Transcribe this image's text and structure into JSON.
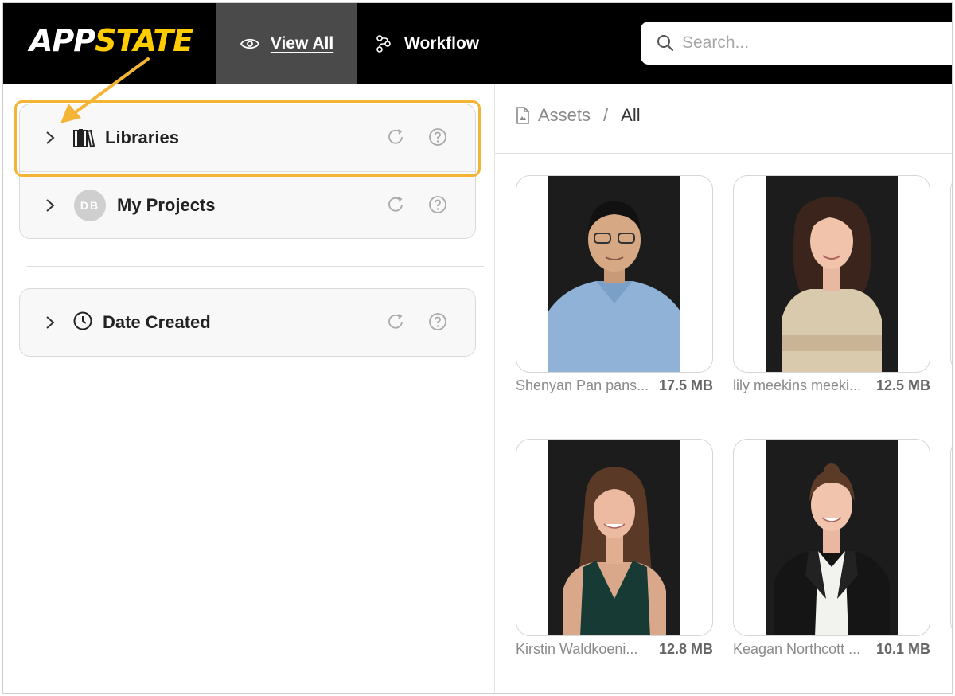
{
  "header": {
    "logo_app": "APP",
    "logo_state": "STATE",
    "nav": [
      {
        "label": "View All",
        "icon": "eye-icon",
        "active": true
      },
      {
        "label": "Workflow",
        "icon": "workflow-icon",
        "active": false
      }
    ],
    "search_placeholder": "Search..."
  },
  "sidebar": {
    "groups": [
      {
        "label": "Libraries",
        "icon": "books-icon"
      },
      {
        "label": "My Projects",
        "avatar": "DB"
      },
      {
        "label": "Date Created",
        "icon": "clock-icon"
      }
    ]
  },
  "breadcrumb": {
    "root": "Assets",
    "separator": "/",
    "current": "All"
  },
  "assets": [
    {
      "name": "Shenyan Pan pans...",
      "size": "17.5 MB"
    },
    {
      "name": "lily meekins meeki...",
      "size": "12.5 MB"
    },
    {
      "name": "Kirstin Waldkoeni...",
      "size": "12.8 MB"
    },
    {
      "name": "Keagan Northcott ...",
      "size": "10.1 MB"
    }
  ],
  "colors": {
    "highlight": "#f4b436",
    "brand_yellow": "#ffcc00",
    "topbar": "#000000",
    "active_nav": "#4a4a4a"
  }
}
